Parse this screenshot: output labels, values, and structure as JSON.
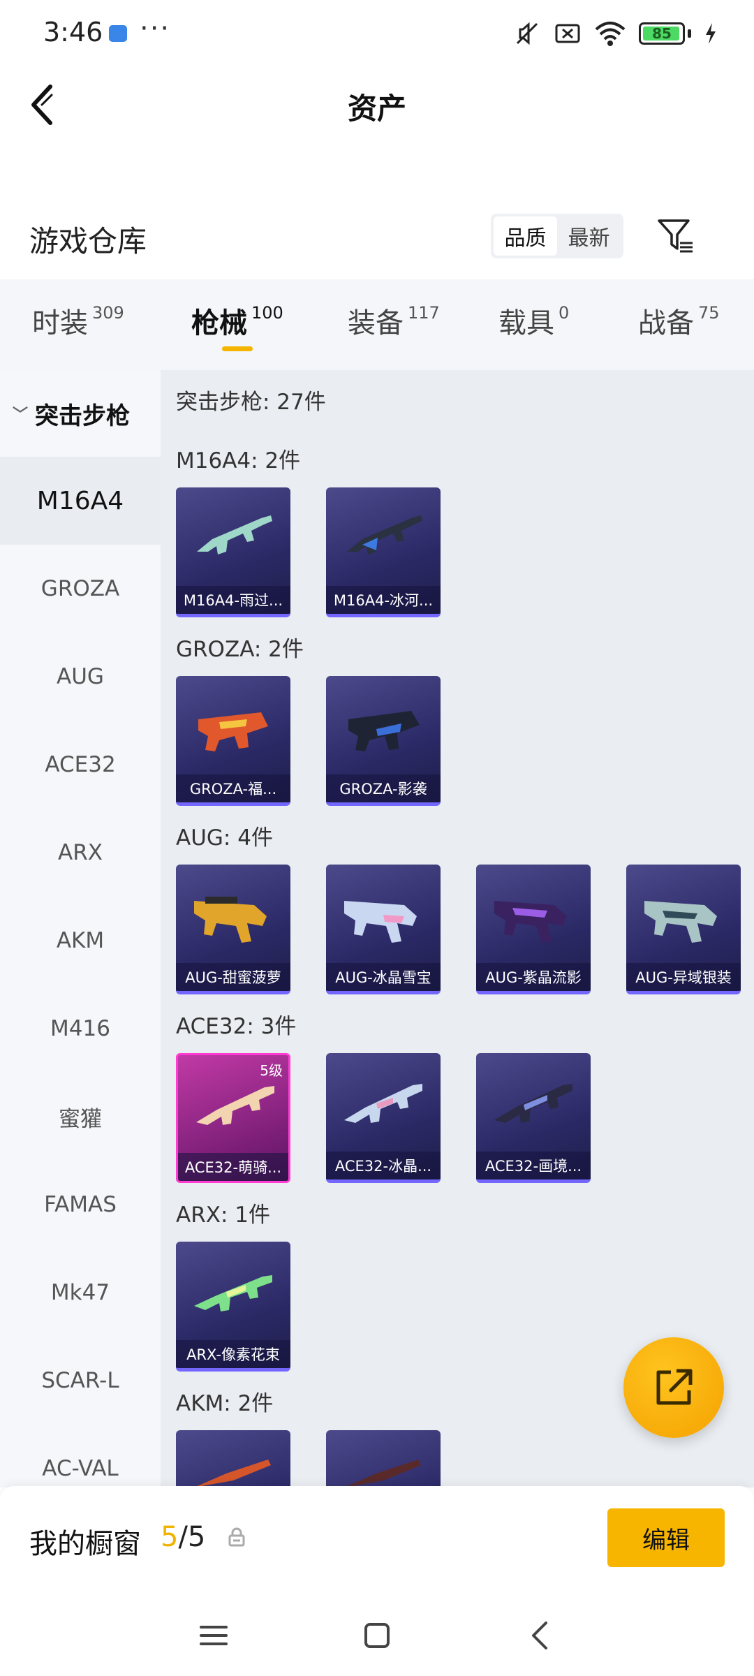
{
  "status_bar": {
    "time": "3:46",
    "dots": "···",
    "battery": "85"
  },
  "header": {
    "title": "资产",
    "back_icon": "chevron-left-icon"
  },
  "warehouse": {
    "title": "游戏仓库",
    "sort_options": [
      "品质",
      "最新"
    ],
    "sort_selected": "品质",
    "filter_icon": "filter-icon"
  },
  "tabs": [
    {
      "label": "时装",
      "count": "309"
    },
    {
      "label": "枪械",
      "count": "100",
      "active": true
    },
    {
      "label": "装备",
      "count": "117"
    },
    {
      "label": "载具",
      "count": "0"
    },
    {
      "label": "战备",
      "count": "75"
    }
  ],
  "sidebar": {
    "category": "突击步枪",
    "items": [
      "M16A4",
      "GROZA",
      "AUG",
      "ACE32",
      "ARX",
      "AKM",
      "M416",
      "蜜獾",
      "FAMAS",
      "Mk47",
      "SCAR-L",
      "AC-VAL"
    ],
    "selected": "M16A4"
  },
  "content": {
    "summary": "突击步枪: 27件",
    "groups": [
      {
        "heading": "M16A4: 2件",
        "items": [
          {
            "label": "M16A4-雨过..."
          },
          {
            "label": "M16A4-冰河..."
          }
        ]
      },
      {
        "heading": "GROZA: 2件",
        "items": [
          {
            "label": "GROZA-福..."
          },
          {
            "label": "GROZA-影袭"
          }
        ]
      },
      {
        "heading": "AUG: 4件",
        "items": [
          {
            "label": "AUG-甜蜜菠萝"
          },
          {
            "label": "AUG-冰晶雪宝"
          },
          {
            "label": "AUG-紫晶流影"
          },
          {
            "label": "AUG-异域银装"
          }
        ]
      },
      {
        "heading": "ACE32: 3件",
        "items": [
          {
            "label": "ACE32-萌骑...",
            "badge": "5级",
            "quality": "pink"
          },
          {
            "label": "ACE32-冰晶..."
          },
          {
            "label": "ACE32-画境..."
          }
        ]
      },
      {
        "heading": "ARX: 1件",
        "items": [
          {
            "label": "ARX-像素花束"
          }
        ]
      },
      {
        "heading": "AKM: 2件",
        "items": [
          {
            "label": ""
          },
          {
            "label": ""
          }
        ]
      }
    ]
  },
  "showcase": {
    "label": "我的橱窗",
    "current": "5",
    "total": "/5",
    "edit_label": "编辑"
  },
  "colors": {
    "accent": "#f7b500",
    "card_bg": "#2b2966",
    "card_pink": "#c13aa5"
  }
}
